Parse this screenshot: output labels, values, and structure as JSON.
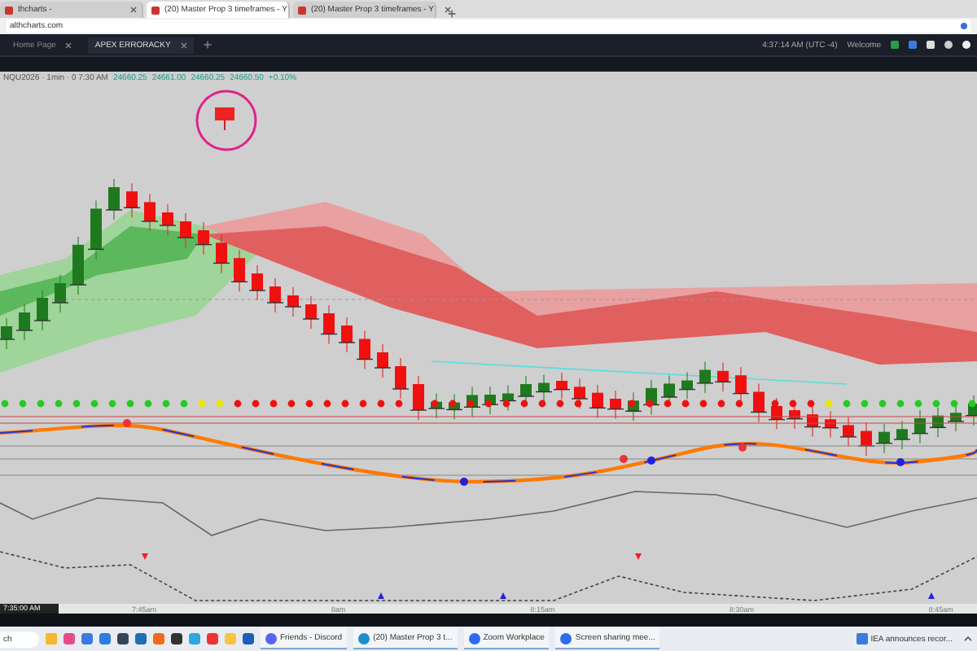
{
  "browser": {
    "tabs": [
      {
        "title": "thcharts -",
        "selected": false
      },
      {
        "title": "(20) Master Prop 3 timeframes - Y",
        "selected": true
      },
      {
        "title": "(20) Master Prop 3 timeframes - Y",
        "selected": false
      }
    ],
    "address": "althcharts.com"
  },
  "app": {
    "tabs": [
      {
        "label": "Home Page",
        "selected": false
      },
      {
        "label": "APEX ERRORACKY",
        "selected": true
      }
    ],
    "clock": "4:37:14 AM (UTC -4)",
    "welcome": "Welcome"
  },
  "chart": {
    "symbol": "NQU2026 · 1min · 0 7:30 AM",
    "values": [
      "24660.25",
      "24661.00",
      "24660.25",
      "24660.50",
      "+0.10%"
    ],
    "cursor_time": "7:35:00 AM",
    "time_labels": [
      "7:45am",
      "8am",
      "8:15am",
      "8:30am",
      "8:45am"
    ]
  },
  "taskbar": {
    "search": "ch",
    "apps": [
      {
        "label": "Friends - Discord",
        "kind": "discord"
      },
      {
        "label": "(20) Master Prop 3 t...",
        "kind": "edge"
      },
      {
        "label": "Zoom Workplace",
        "kind": "zoom"
      },
      {
        "label": "Screen sharing mee...",
        "kind": "zoom"
      }
    ],
    "news": "IEA announces recor..."
  }
}
